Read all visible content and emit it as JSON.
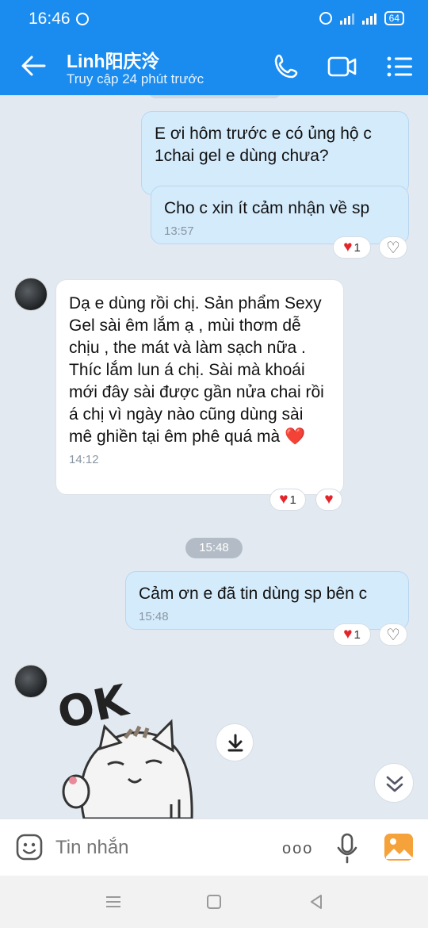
{
  "status": {
    "time": "16:46",
    "battery": "64"
  },
  "header": {
    "name": "Linh阳庆泠",
    "status": "Truy cập 24 phút trước"
  },
  "messages": {
    "m1": "E ơi hôm trước e có ủng hộ c 1chai gel e dùng chưa?",
    "m2": "Cho c xin ít cảm nhận về sp",
    "m2_time": "13:57",
    "m2_reaction": "1",
    "m3": " Dạ e dùng rồi chị. Sản phẩm Sexy Gel sài êm lắm ạ , mùi thơm dễ chịu , the mát và làm sạch nữa . Thíc lắm lun á chị. Sài mà khoái mới đây sài được gần nửa chai rồi á chị vì ngày nào cũng dùng sài mê ghiền tại êm phê quá mà ❤️",
    "m3_time": "14:12",
    "m3_reaction": "1",
    "divider": "15:48",
    "m4": "Cảm ơn e đã tin dùng sp bên c",
    "m4_time": "15:48",
    "m4_reaction": "1",
    "sticker_text": "OK"
  },
  "composer": {
    "placeholder": "Tin nhắn",
    "more": "ooo"
  },
  "colors": {
    "header": "#1a8cf0",
    "outgoing": "#d4ebfc",
    "incoming": "#ffffff",
    "background": "#e2e9f1",
    "heart": "#e3242b"
  },
  "icons": [
    "back-arrow-icon",
    "phone-icon",
    "video-icon",
    "menu-icon",
    "emoji-icon",
    "mic-icon",
    "image-icon",
    "download-icon",
    "chevron-double-down-icon"
  ]
}
